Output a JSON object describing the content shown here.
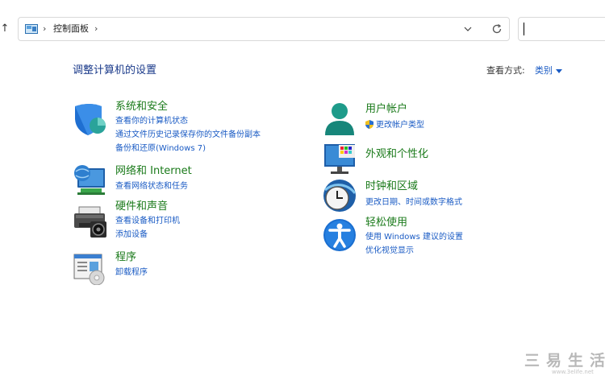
{
  "nav": {
    "up_arrow": "↑"
  },
  "address": {
    "crumb": "控制面板",
    "chevron": "›"
  },
  "search": {
    "value": ""
  },
  "header": {
    "title": "调整计算机的设置",
    "view_label": "查看方式:",
    "view_value": "类别"
  },
  "categories": [
    {
      "title": "系统和安全",
      "icon": "shield-icon",
      "links": [
        "查看你的计算机状态",
        "通过文件历史记录保存你的文件备份副本",
        "备份和还原(Windows 7)"
      ]
    },
    {
      "title": "网络和 Internet",
      "icon": "network-icon",
      "links": [
        "查看网络状态和任务"
      ]
    },
    {
      "title": "硬件和声音",
      "icon": "printer-icon",
      "links": [
        "查看设备和打印机",
        "添加设备"
      ]
    },
    {
      "title": "程序",
      "icon": "programs-icon",
      "links": [
        "卸载程序"
      ]
    },
    {
      "title": "用户帐户",
      "icon": "user-icon",
      "links": [
        "更改帐户类型"
      ]
    },
    {
      "title": "外观和个性化",
      "icon": "appearance-icon",
      "links": []
    },
    {
      "title": "时钟和区域",
      "icon": "clock-icon",
      "links": [
        "更改日期、时间或数字格式"
      ]
    },
    {
      "title": "轻松使用",
      "icon": "accessibility-icon",
      "links": [
        "使用 Windows 建议的设置",
        "优化视觉显示"
      ]
    }
  ],
  "watermark": {
    "text": "三易生活",
    "url": "www.3elife.net"
  },
  "colors": {
    "title_green": "#1a7a1a",
    "link_blue": "#1a5bc4",
    "heading_blue": "#1a3a8a"
  }
}
